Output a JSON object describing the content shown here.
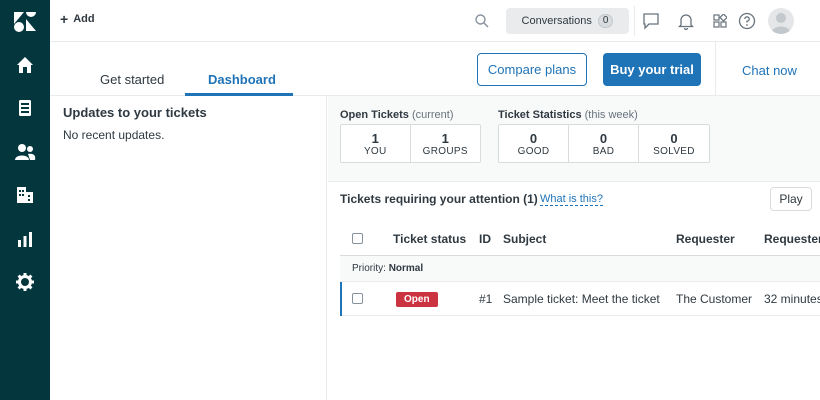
{
  "topbar": {
    "add_label": "Add",
    "conversations_label": "Conversations",
    "conversations_count": "0"
  },
  "tabs": [
    {
      "label": "Get started"
    },
    {
      "label": "Dashboard"
    }
  ],
  "buttons": {
    "compare_plans": "Compare plans",
    "buy_trial": "Buy your trial",
    "chat_now": "Chat now"
  },
  "updates": {
    "title": "Updates to your tickets",
    "empty": "No recent updates."
  },
  "open_tickets": {
    "title": "Open Tickets",
    "subtitle": "(current)",
    "cells": [
      {
        "value": "1",
        "label": "YOU"
      },
      {
        "value": "1",
        "label": "GROUPS"
      }
    ]
  },
  "ticket_stats": {
    "title": "Ticket Statistics",
    "subtitle": "(this week)",
    "cells": [
      {
        "value": "0",
        "label": "GOOD"
      },
      {
        "value": "0",
        "label": "BAD"
      },
      {
        "value": "0",
        "label": "SOLVED"
      }
    ]
  },
  "view": {
    "title": "Tickets requiring your attention (1)",
    "help_link": "What is this?",
    "play_label": "Play"
  },
  "table": {
    "headers": [
      "Ticket status",
      "ID",
      "Subject",
      "Requester",
      "Requester"
    ],
    "group": {
      "label": "Priority:",
      "value": "Normal"
    },
    "rows": [
      {
        "status": "Open",
        "id": "#1",
        "subject": "Sample ticket: Meet the ticket",
        "requester": "The Customer",
        "requested": "32 minutes"
      }
    ]
  },
  "colors": {
    "sidebar": "#03363d",
    "accent": "#1f73b7",
    "status_open": "#cc3340"
  }
}
